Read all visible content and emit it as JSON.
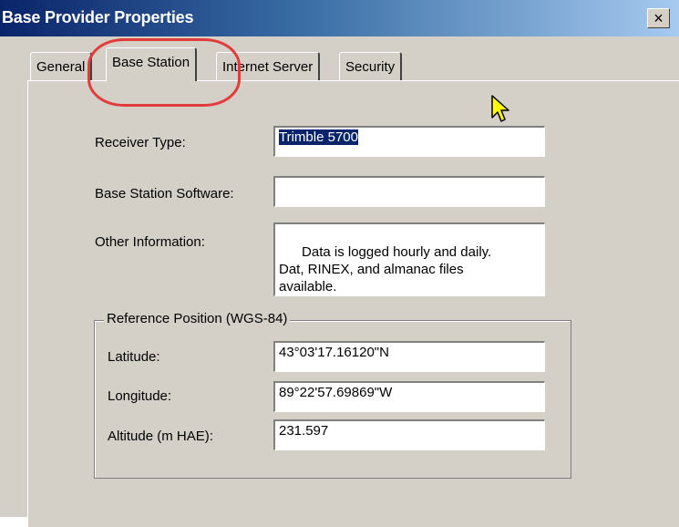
{
  "window": {
    "title": "Base Provider Properties",
    "close_symbol": "×"
  },
  "tabs": [
    {
      "label": "General",
      "active": false
    },
    {
      "label": "Base Station",
      "active": true
    },
    {
      "label": "Internet Server",
      "active": false
    },
    {
      "label": "Security",
      "active": false
    }
  ],
  "form": {
    "receiver_type_label": "Receiver Type:",
    "receiver_type_value": "Trimble 5700",
    "base_station_software_label": "Base Station Software:",
    "base_station_software_value": "",
    "other_information_label": "Other Information:",
    "other_information_value": "Data is logged hourly and daily.\nDat, RINEX, and almanac files\navailable."
  },
  "reference_position": {
    "legend": "Reference Position (WGS-84)",
    "latitude_label": "Latitude:",
    "latitude_value": "43°03'17.16120\"N",
    "longitude_label": "Longitude:",
    "longitude_value": "89°22'57.69869\"W",
    "altitude_label": "Altitude (m HAE):",
    "altitude_value": "231.597"
  },
  "annotation": {
    "highlight_color": "#e23b3b",
    "cursor_color": "#ffff00"
  }
}
